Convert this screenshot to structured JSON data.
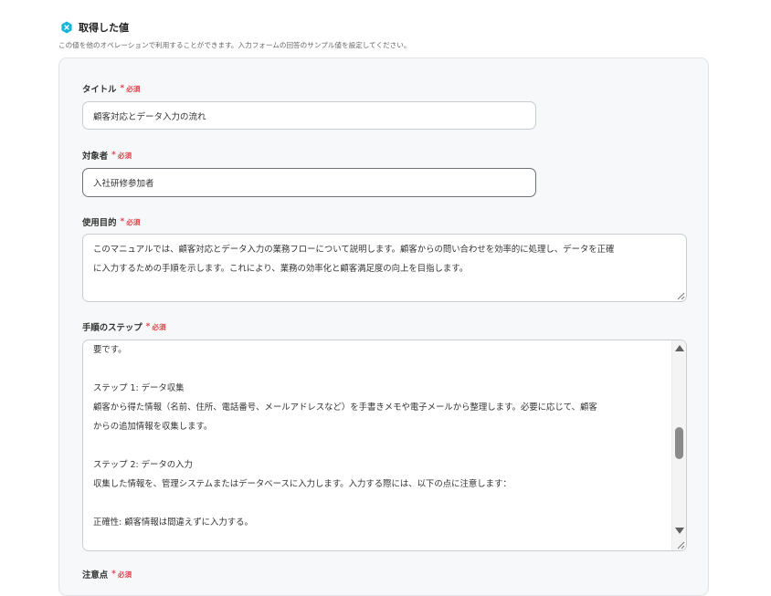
{
  "header": {
    "title": "取得した値",
    "icon": "hexagon-x-icon",
    "icon_color": "#18b4d8",
    "description": "この値を他のオペレーションで利用することができます。入力フォームの回答のサンプル値を設定してください。"
  },
  "form": {
    "required_mark": "*",
    "required_text": "必須",
    "required_color": "#e0434b",
    "fields": [
      {
        "label": "タイトル",
        "value": "顧客対応とデータ入力の流れ"
      },
      {
        "label": "対象者",
        "value": "入社研修参加者"
      },
      {
        "label": "使用目的",
        "lines": [
          "このマニュアルでは、顧客対応とデータ入力の業務フローについて説明します。顧客からの問い合わせを効率的に処理し、データを正確",
          "に入力するための手順を示します。これにより、業務の効率化と顧客満足度の向上を目指します。"
        ]
      },
      {
        "label": "手順のステップ",
        "lines": [
          "要です。",
          "",
          "ステップ 1: データ収集",
          "顧客から得た情報（名前、住所、電話番号、メールアドレスなど）を手書きメモや電子メールから整理します。必要に応じて、顧客",
          "からの追加情報を収集します。",
          "",
          "ステップ 2: データの入力",
          "収集した情報を、管理システムまたはデータベースに入力します。入力する際には、以下の点に注意します：",
          "",
          "正確性: 顧客情報は間違えずに入力する。"
        ]
      },
      {
        "label": "注意点"
      }
    ]
  }
}
